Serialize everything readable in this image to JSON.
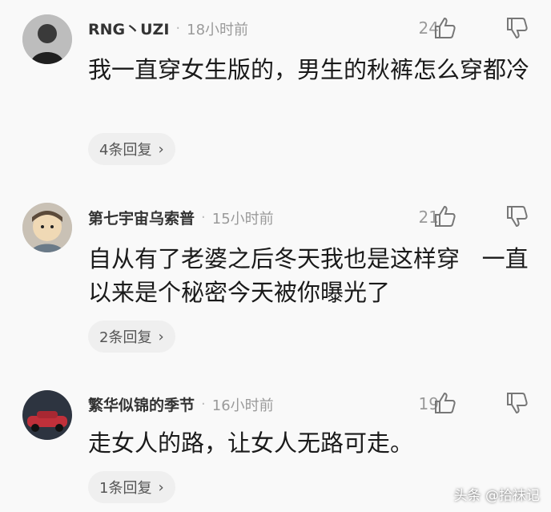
{
  "colors": {
    "background": "#f9f9f9",
    "meta_text": "#9a9a9a",
    "body_text": "#1a1a1a",
    "pill": "#efefef"
  },
  "comments": [
    {
      "username": "RNG丶UZI",
      "separator": "·",
      "time": "18小时前",
      "likes": "24",
      "text": "我一直穿女生版的，男生的秋裤怎么穿都冷",
      "replies": "4条回复",
      "icons": {
        "like": "thumbs-up-icon",
        "dislike": "thumbs-down-icon",
        "chevron": "chevron-right-icon"
      }
    },
    {
      "username": "第七宇宙乌索普",
      "separator": "·",
      "time": "15小时前",
      "likes": "21",
      "text": "自从有了老婆之后冬天我也是这样穿   一直以来是个秘密今天被你曝光了",
      "replies": "2条回复",
      "icons": {
        "like": "thumbs-up-icon",
        "dislike": "thumbs-down-icon",
        "chevron": "chevron-right-icon"
      }
    },
    {
      "username": "繁华似锦的季节",
      "separator": "·",
      "time": "16小时前",
      "likes": "19",
      "text": "走女人的路，让女人无路可走。",
      "replies": "1条回复",
      "icons": {
        "like": "thumbs-up-icon",
        "dislike": "thumbs-down-icon",
        "chevron": "chevron-right-icon"
      }
    }
  ],
  "watermark": {
    "text": "头条 @拾袜记"
  }
}
